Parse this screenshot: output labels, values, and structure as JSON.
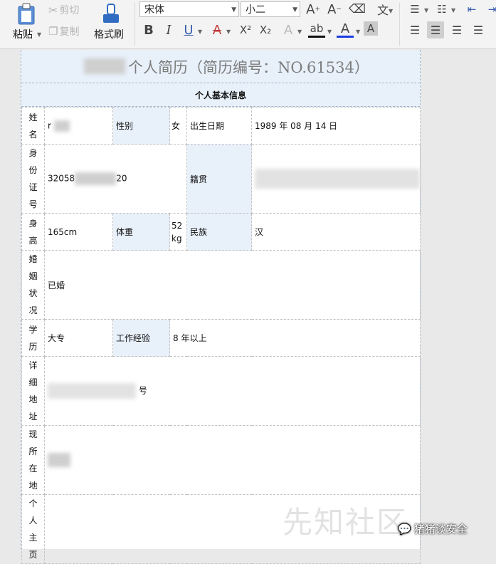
{
  "ribbon": {
    "paste": "粘贴",
    "cut": "剪切",
    "copy": "复制",
    "format_painter": "格式刷",
    "font_name": "宋体",
    "font_size": "小二",
    "bold": "B",
    "italic": "I",
    "underline": "U",
    "strike": "A",
    "superscript": "X²",
    "subscript": "X₂",
    "text_effect": "A",
    "highlight": "ab",
    "font_color": "A",
    "char_shading": "A",
    "grow_font": "A",
    "shrink_font": "A",
    "phonetic": "文"
  },
  "document": {
    "title": "个人简历（简历编号：NO.61534）",
    "section_header": "个人基本信息",
    "rows": {
      "name_label": "姓名",
      "name_value": "r",
      "gender_label": "性别",
      "gender_value": "女",
      "birth_label": "出生日期",
      "birth_value": "1989 年 08 月 14 日",
      "id_label": "身份证号",
      "id_value_prefix": "32058",
      "id_value_suffix": "20",
      "native_label": "籍贯",
      "height_label": "身高",
      "height_value": "165cm",
      "weight_label": "体重",
      "weight_value_num": "52",
      "weight_value_unit": "kg",
      "ethnic_label": "民族",
      "ethnic_value": "汉",
      "marital_label": "婚姻状况",
      "marital_value": "已婚",
      "edu_label": "学历",
      "edu_value": "大专",
      "exp_label": "工作经验",
      "exp_value": "8 年以上",
      "address_label": "详细地址",
      "address_value": "号",
      "current_label": "现所在地",
      "homepage_label": "个人主页"
    }
  },
  "watermark": "先知社区",
  "wechat_badge": "猪猪谈安全"
}
